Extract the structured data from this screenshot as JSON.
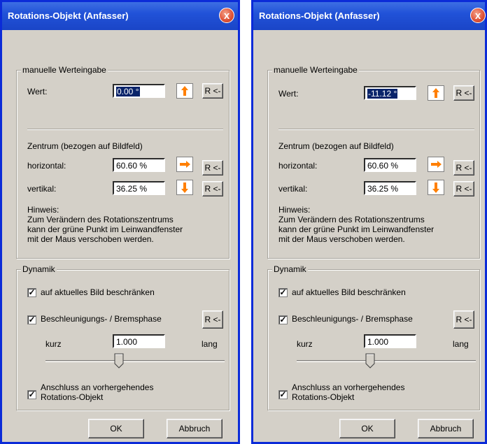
{
  "dialog_left": {
    "title": "Rotations-Objekt (Anfasser)",
    "close_label": "x",
    "group_manual": "manuelle Werteingabe",
    "wert_label": "Wert:",
    "wert_value": "0.00 °",
    "reset_label": "R <-",
    "zentrum_label": "Zentrum (bezogen auf Bildfeld)",
    "horizontal_label": "horizontal:",
    "horizontal_value": "60.60 %",
    "vertikal_label": "vertikal:",
    "vertikal_value": "36.25 %",
    "hint_lines": [
      "Hinweis:",
      "Zum Verändern des Rotationszentrums",
      "kann der grüne Punkt im Leinwandfenster",
      "mit der Maus verschoben werden."
    ],
    "group_dynamik": "Dynamik",
    "chk1_label": "auf aktuelles Bild beschränken",
    "chk2_label": "Beschleunigungs- / Bremsphase",
    "kurz_label": "kurz",
    "slider_value": "1.000",
    "lang_label": "lang",
    "chk3_line1": "Anschluss an vorhergehendes",
    "chk3_line2": "Rotations-Objekt",
    "ok_label": "OK",
    "cancel_label": "Abbruch",
    "check_mark": "✓"
  },
  "dialog_right": {
    "title": "Rotations-Objekt (Anfasser)",
    "close_label": "x",
    "group_manual": "manuelle Werteingabe",
    "wert_label": "Wert:",
    "wert_value": "-11.12 °",
    "reset_label": "R <-",
    "zentrum_label": "Zentrum (bezogen auf Bildfeld)",
    "horizontal_label": "horizontal:",
    "horizontal_value": "60.60 %",
    "vertikal_label": "vertikal:",
    "vertikal_value": "36.25 %",
    "hint_lines": [
      "Hinweis:",
      "Zum Verändern des Rotationszentrums",
      "kann der grüne Punkt im Leinwandfenster",
      "mit der Maus verschoben werden."
    ],
    "group_dynamik": "Dynamik",
    "chk1_label": "auf aktuelles Bild beschränken",
    "chk2_label": "Beschleunigungs- / Bremsphase",
    "kurz_label": "kurz",
    "slider_value": "1.000",
    "lang_label": "lang",
    "chk3_line1": "Anschluss an vorhergehendes",
    "chk3_line2": "Rotations-Objekt",
    "ok_label": "OK",
    "cancel_label": "Abbruch",
    "check_mark": "✓"
  },
  "colors": {
    "title_bar": "#2152d8",
    "dialog_face": "#d4d0c8",
    "arrow_orange": "#ff7f00",
    "selection": "#0a246a"
  },
  "icons": {
    "rotate_dir": "arrow-up-icon",
    "horizontal_dir": "arrow-right-icon",
    "vertical_dir": "arrow-down-icon",
    "close": "close-icon"
  }
}
